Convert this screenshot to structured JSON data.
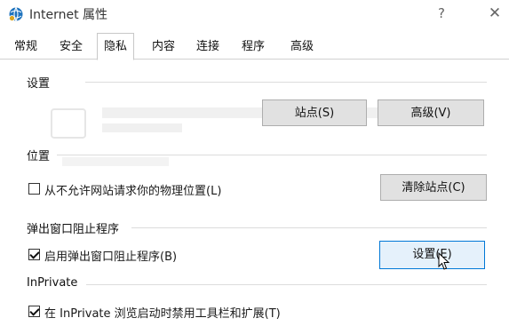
{
  "window": {
    "title": "Internet 属性",
    "help_glyph": "?",
    "close_glyph": "✕"
  },
  "tabs": [
    {
      "label": "常规"
    },
    {
      "label": "安全"
    },
    {
      "label": "隐私"
    },
    {
      "label": "内容"
    },
    {
      "label": "连接"
    },
    {
      "label": "程序"
    },
    {
      "label": "高级"
    }
  ],
  "active_tab": "隐私",
  "settings_group": {
    "label": "设置",
    "sites_button": "站点(S)",
    "advanced_button": "高级(V)"
  },
  "location_group": {
    "label": "位置",
    "never_allow_checkbox": {
      "label": "从不允许网站请求你的物理位置(L)",
      "checked": false
    },
    "clear_sites_button": "清除站点(C)"
  },
  "popup_group": {
    "label": "弹出窗口阻止程序",
    "enable_checkbox": {
      "label": "启用弹出窗口阻止程序(B)",
      "checked": true
    },
    "settings_button": "设置(E)"
  },
  "inprivate_group": {
    "label": "InPrivate",
    "disable_toolbars_checkbox": {
      "label": "在 InPrivate 浏览启动时禁用工具栏和扩展(T)",
      "checked": true
    }
  },
  "colors": {
    "accent": "#0078d7",
    "button_bg": "#e1e1e1",
    "button_border": "#adadad",
    "icon_blue": "#1e73be"
  }
}
